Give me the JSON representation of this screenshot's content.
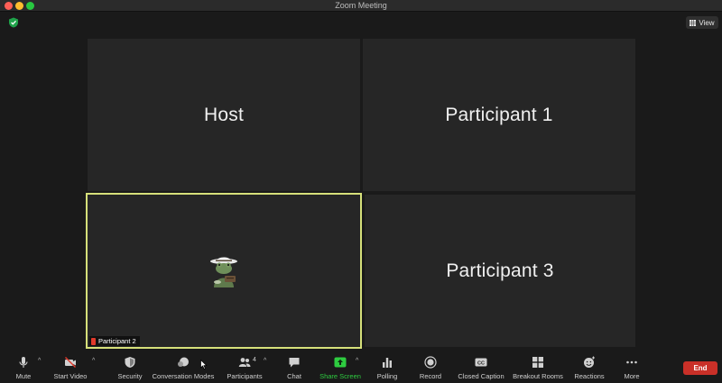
{
  "window": {
    "title": "Zoom Meeting"
  },
  "header": {
    "view_label": "View"
  },
  "tiles": [
    {
      "name": "Host"
    },
    {
      "name": "Participant 1"
    },
    {
      "name": "Participant 2"
    },
    {
      "name": "Participant 3"
    }
  ],
  "toolbar": {
    "mute": "Mute",
    "start_video": "Start Video",
    "security": "Security",
    "conversation_modes": "Conversation Modes",
    "participants": "Participants",
    "participants_count": "4",
    "chat": "Chat",
    "share_screen": "Share Screen",
    "polling": "Polling",
    "record": "Record",
    "closed_caption": "Closed Caption",
    "breakout_rooms": "Breakout Rooms",
    "reactions": "Reactions",
    "more": "More",
    "end": "End",
    "cc_badge": "CC"
  },
  "colors": {
    "active_speaker_border": "#d6e07a",
    "share_green": "#2ecc40",
    "end_red": "#c93028",
    "tile_bg": "#262626"
  }
}
